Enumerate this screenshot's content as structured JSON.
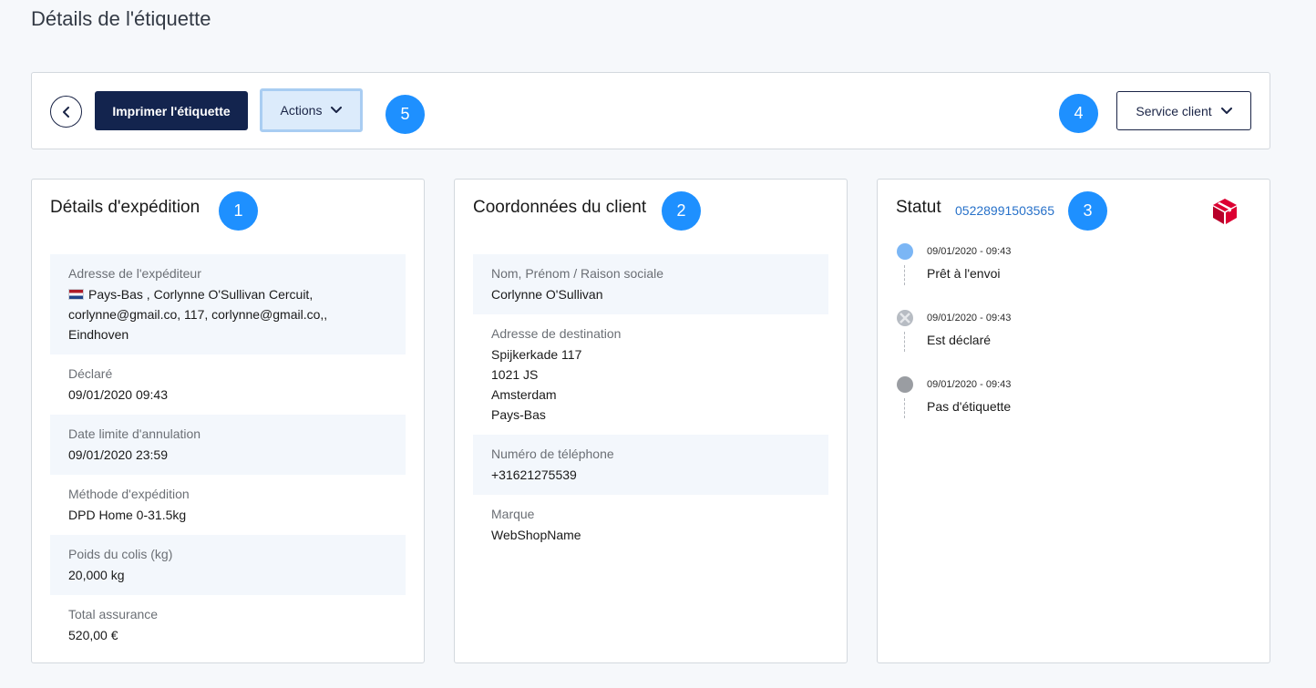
{
  "page": {
    "title": "Détails de l'étiquette"
  },
  "toolbar": {
    "print_label": "Imprimer l'étiquette",
    "actions_label": "Actions",
    "service_label": "Service client"
  },
  "badges": [
    "1",
    "2",
    "3",
    "4",
    "5"
  ],
  "shipping": {
    "title": "Détails d'expédition",
    "fields": [
      {
        "label": "Adresse de l'expéditeur",
        "value_lines": [
          "Pays-Bas , Corlynne O'Sullivan Cercuit,",
          "corlynne@gmail.co, 117, corlynne@gmail.co,,",
          "Eindhoven"
        ]
      },
      {
        "label": "Déclaré",
        "value_lines": [
          "09/01/2020 09:43"
        ]
      },
      {
        "label": "Date limite d'annulation",
        "value_lines": [
          "09/01/2020 23:59"
        ]
      },
      {
        "label": "Méthode d'expédition",
        "value_lines": [
          "DPD Home 0-31.5kg"
        ]
      },
      {
        "label": "Poids du colis (kg)",
        "value_lines": [
          "20,000 kg"
        ]
      },
      {
        "label": "Total assurance",
        "value_lines": [
          "520,00 €"
        ]
      }
    ]
  },
  "customer": {
    "title": "Coordonnées du client",
    "fields": [
      {
        "label": "Nom, Prénom / Raison sociale",
        "value_lines": [
          "Corlynne O'Sullivan"
        ]
      },
      {
        "label": "Adresse de destination",
        "value_lines": [
          "Spijkerkade 117",
          "1021 JS",
          "Amsterdam",
          "Pays-Bas"
        ]
      },
      {
        "label": "Numéro de téléphone",
        "value_lines": [
          "+31621275539"
        ]
      },
      {
        "label": "Marque",
        "value_lines": [
          "WebShopName"
        ]
      }
    ]
  },
  "status": {
    "title": "Statut",
    "tracking_number": "05228991503565",
    "carrier_icon": "dpd-logo-icon",
    "events": [
      {
        "time": "09/01/2020 - 09:43",
        "text": "Prêt à l'envoi",
        "dot": "blue"
      },
      {
        "time": "09/01/2020 - 09:43",
        "text": "Est déclaré",
        "dot": "cross"
      },
      {
        "time": "09/01/2020 - 09:43",
        "text": "Pas d'étiquette",
        "dot": "grey"
      }
    ]
  },
  "colors": {
    "primary": "#13244e",
    "accent": "#1e90ff",
    "link": "#2771c9",
    "brand_dpd": "#dc0032"
  }
}
